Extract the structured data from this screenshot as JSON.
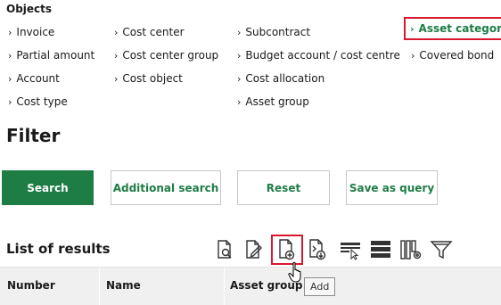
{
  "objects": {
    "title": "Objects",
    "links": [
      {
        "label": "Invoice"
      },
      {
        "label": "Partial amount"
      },
      {
        "label": "Account"
      },
      {
        "label": "Cost type"
      },
      {
        "label": "Cost center"
      },
      {
        "label": "Cost center group"
      },
      {
        "label": "Cost object"
      },
      {
        "label": "Subcontract"
      },
      {
        "label": "Budget account / cost centre"
      },
      {
        "label": "Cost allocation"
      },
      {
        "label": "Asset group"
      },
      {
        "label": "Asset category"
      },
      {
        "label": "Covered bond"
      }
    ]
  },
  "filter": {
    "title": "Filter",
    "buttons": {
      "search": "Search",
      "additional_search": "Additional search",
      "reset": "Reset",
      "save_as_query": "Save as query"
    }
  },
  "results": {
    "title": "List of results",
    "toolbar": [
      {
        "icon": "document-search-icon"
      },
      {
        "icon": "document-edit-icon"
      },
      {
        "icon": "document-add-icon"
      },
      {
        "icon": "document-download-icon"
      },
      {
        "icon": "select-columns-icon"
      },
      {
        "icon": "row-density-icon"
      },
      {
        "icon": "column-settings-icon"
      },
      {
        "icon": "filter-icon"
      }
    ],
    "tooltip": "Add",
    "columns": [
      "Number",
      "Name",
      "Asset group"
    ]
  },
  "colors": {
    "accent": "#1e7d45",
    "highlight_border": "#d9182d"
  }
}
